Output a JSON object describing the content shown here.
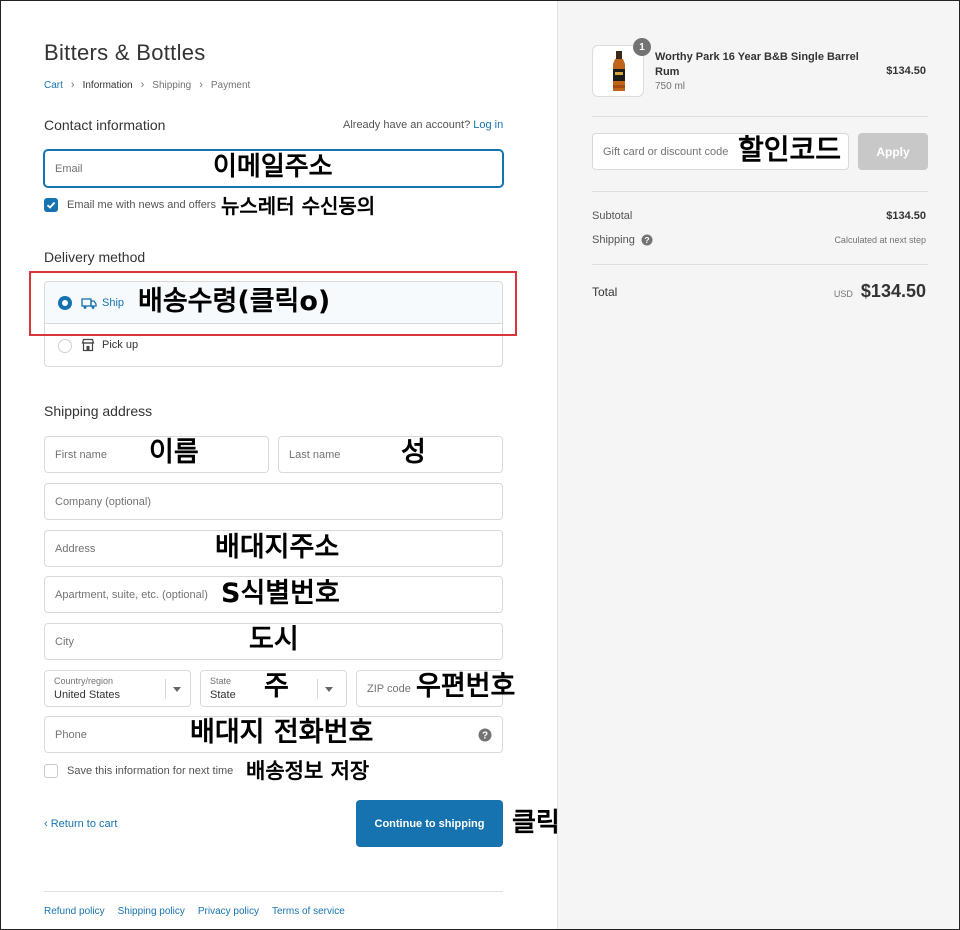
{
  "store": {
    "name": "Bitters & Bottles"
  },
  "breadcrumb": {
    "cart": "Cart",
    "information": "Information",
    "shipping": "Shipping",
    "payment": "Payment"
  },
  "contact": {
    "title": "Contact information",
    "have_account": "Already have an account?",
    "login": "Log in",
    "email_placeholder": "Email",
    "news_label": "Email me with news and offers"
  },
  "delivery": {
    "title": "Delivery method",
    "ship": "Ship",
    "pickup": "Pick up"
  },
  "shipping": {
    "title": "Shipping address",
    "first_name": "First name",
    "last_name": "Last name",
    "company": "Company (optional)",
    "address": "Address",
    "apartment": "Apartment, suite, etc. (optional)",
    "city": "City",
    "country_label": "Country/region",
    "country_value": "United States",
    "state_label": "State",
    "state_value": "State",
    "zip": "ZIP code",
    "phone": "Phone",
    "save_label": "Save this information for next time"
  },
  "actions": {
    "return": "Return to cart",
    "continue": "Continue to shipping"
  },
  "footer": {
    "refund": "Refund policy",
    "shipping": "Shipping policy",
    "privacy": "Privacy policy",
    "terms": "Terms of service"
  },
  "summary": {
    "qty_badge": "1",
    "product_name": "Worthy Park 16 Year B&B Single Barrel Rum",
    "product_variant": "750 ml",
    "product_price": "$134.50",
    "discount_placeholder": "Gift card or discount code",
    "apply": "Apply",
    "subtotal_label": "Subtotal",
    "subtotal_value": "$134.50",
    "shipping_label": "Shipping",
    "shipping_value": "Calculated at next step",
    "total_label": "Total",
    "currency": "USD",
    "total_value": "$134.50"
  },
  "annotations": {
    "email": "이메일주소",
    "news": "뉴스레터 수신동의",
    "ship": "배송수령(클릭o)",
    "first_name": "이름",
    "last_name": "성",
    "address": "배대지주소",
    "apartment": "S식별번호",
    "city": "도시",
    "state": "주",
    "zip": "우편번호",
    "phone": "배대지 전화번호",
    "save": "배송정보 저장",
    "click": "클릭",
    "discount": "할인코드"
  },
  "colors": {
    "accent": "#1773b0",
    "highlight_box": "#d9343a",
    "sidebar_bg": "#f5f5f5"
  }
}
